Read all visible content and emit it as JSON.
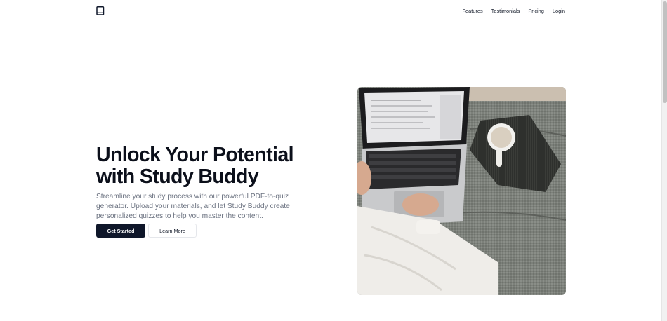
{
  "nav": {
    "logo_icon": "book-icon",
    "links": [
      "Features",
      "Testimonials",
      "Pricing",
      "Login"
    ]
  },
  "hero": {
    "title_line1": "Unlock Your Potential",
    "title_line2": "with Study Buddy",
    "description": "Streamline your study process with our powerful PDF-to-quiz generator. Upload your materials, and let Study Buddy create personalized quizzes to help you master the content.",
    "primary_button": "Get Started",
    "secondary_button": "Learn More",
    "image_subject": "laptop-on-couch-photo"
  },
  "colors": {
    "primary": "#0f172a",
    "muted_text": "#6b7280",
    "border": "#e5e7eb"
  }
}
